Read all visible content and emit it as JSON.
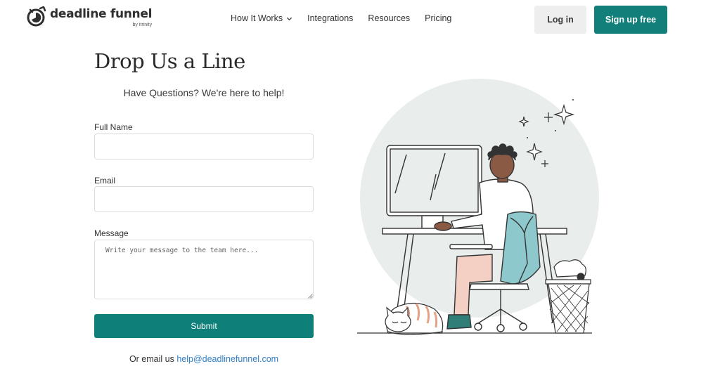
{
  "header": {
    "logo_name": "deadline funnel",
    "logo_by": "by itrinity",
    "nav": [
      {
        "label": "How It Works",
        "has_dropdown": true,
        "icon": "chevron-down-icon"
      },
      {
        "label": "Integrations",
        "has_dropdown": false
      },
      {
        "label": "Resources",
        "has_dropdown": false
      },
      {
        "label": "Pricing",
        "has_dropdown": false
      }
    ],
    "login_label": "Log in",
    "signup_label": "Sign up free"
  },
  "main": {
    "title": "Drop Us a Line",
    "subtitle": "Have Questions? We're here to help!",
    "form": {
      "full_name_label": "Full Name",
      "full_name_value": "",
      "email_label": "Email",
      "email_value": "",
      "message_label": "Message",
      "message_placeholder": "Write your message to the team here...",
      "submit_label": "Submit"
    },
    "email_prefix": "Or email us",
    "email_address": "help@deadlinefunnel.com"
  },
  "colors": {
    "brand_teal": "#137f7b",
    "link_blue": "#2f7fc9",
    "login_bg": "#eeeeee",
    "illus_circle": "#e8eeec",
    "chair_blue": "#8dc9cc",
    "pants_pink": "#f4cfc3"
  }
}
